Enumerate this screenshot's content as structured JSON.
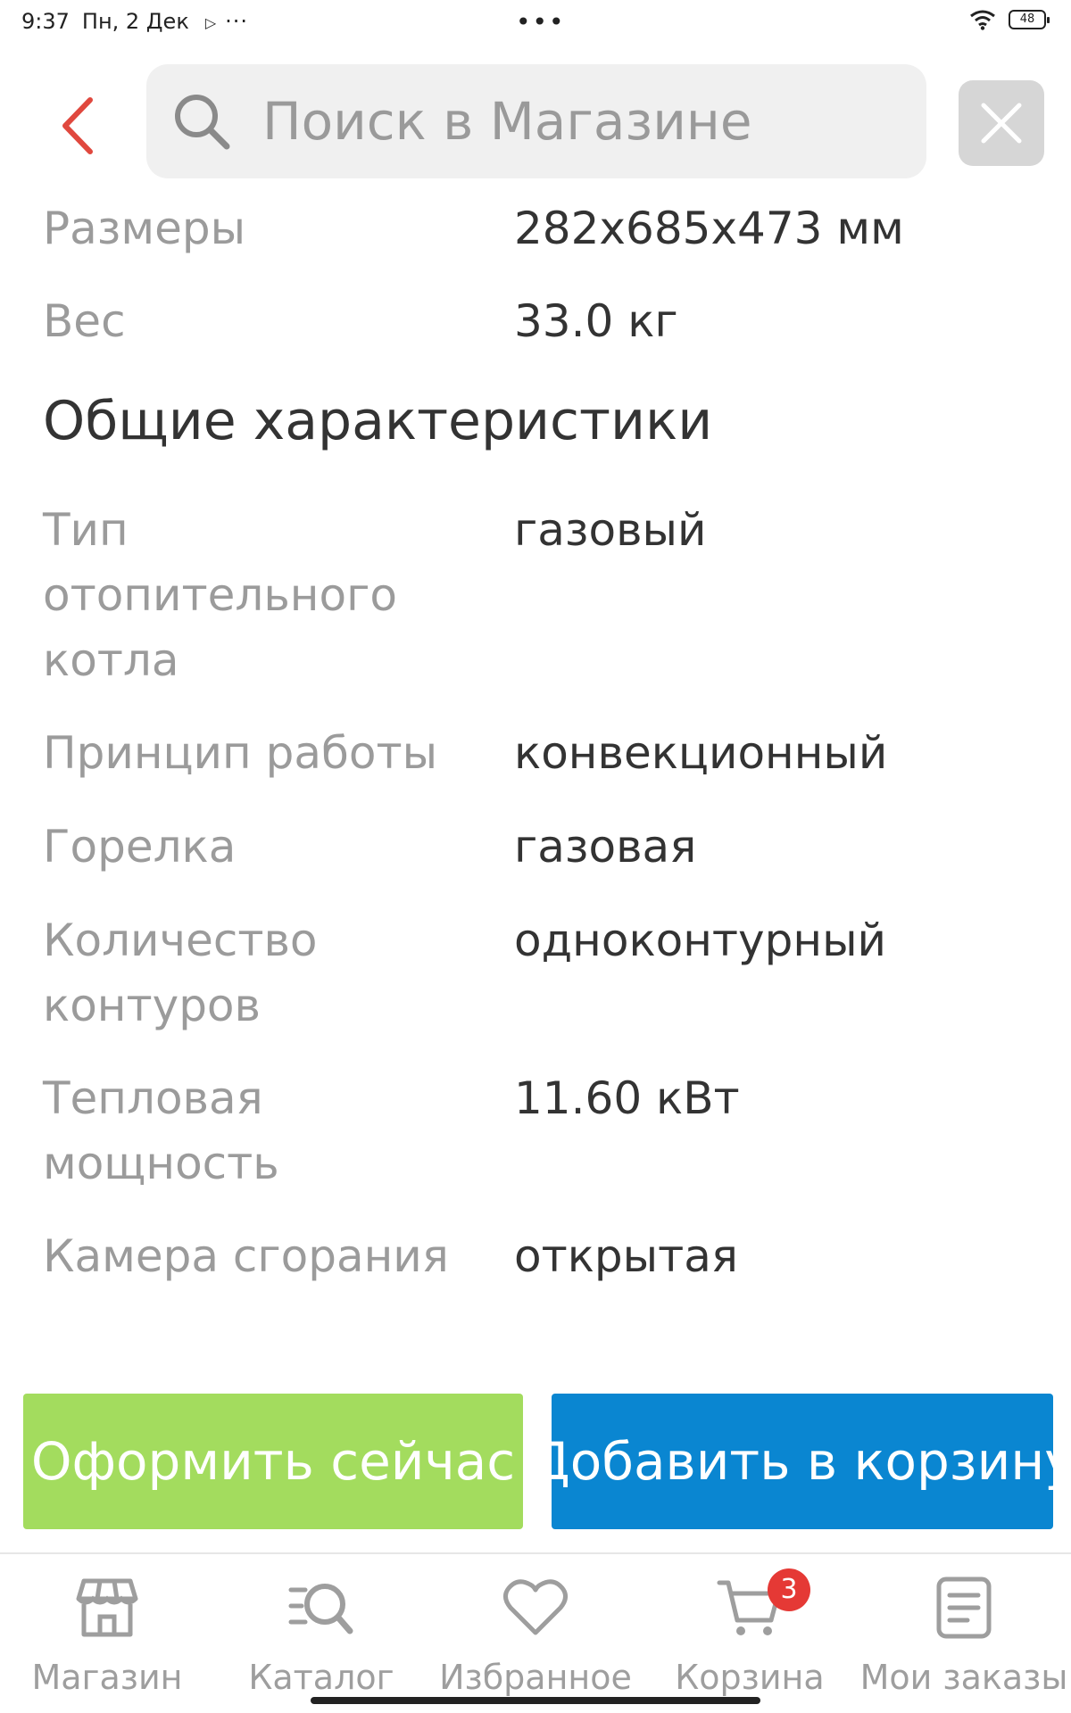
{
  "status_bar": {
    "time": "9:37",
    "date": "Пн, 2 Дек",
    "battery": "48"
  },
  "search": {
    "placeholder": "Поиск в Магазине"
  },
  "specs_top": [
    {
      "label": "Размеры",
      "value": "282x685x473 мм"
    },
    {
      "label": "Вес",
      "value": "33.0 кг"
    }
  ],
  "section": {
    "title": "Общие характеристики"
  },
  "specs_general": [
    {
      "label": "Тип отопительного котла",
      "value": "газовый"
    },
    {
      "label": "Принцип работы",
      "value": "конвекционный"
    },
    {
      "label": "Горелка",
      "value": "газовая"
    },
    {
      "label": "Количество контуров",
      "value": "одноконтурный"
    },
    {
      "label": "Тепловая мощность",
      "value": "11.60 кВт"
    },
    {
      "label": "Камера сгорания",
      "value": "открытая"
    }
  ],
  "actions": {
    "checkout_label": "Оформить сейчас",
    "add_to_cart_label": "Добавить в корзину"
  },
  "nav": {
    "items": [
      {
        "label": "Магазин",
        "icon": "store-icon"
      },
      {
        "label": "Каталог",
        "icon": "catalog-search-icon"
      },
      {
        "label": "Избранное",
        "icon": "heart-icon"
      },
      {
        "label": "Корзина",
        "icon": "cart-icon",
        "badge": "3"
      },
      {
        "label": "Мои заказы",
        "icon": "orders-icon"
      }
    ]
  },
  "colors": {
    "back_arrow": "#e0483e",
    "checkout_bg": "#a3dc5e",
    "add_to_cart_bg": "#0a86d1",
    "badge_bg": "#e53935"
  }
}
